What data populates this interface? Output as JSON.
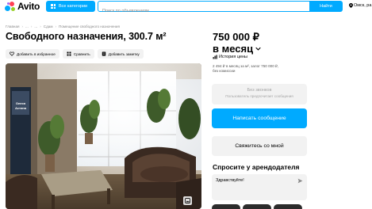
{
  "header": {
    "logo_text": "Avito",
    "categories_label": "Все категории",
    "search_placeholder": "Поиск по объявлениям",
    "search_button": "Найти",
    "location": "Омск, ра"
  },
  "breadcrumb": [
    "Главная",
    "...",
    "...",
    "Сдам",
    "Помещение свободного назначения"
  ],
  "title": "Свободного назначения, 300.7 м²",
  "actions": {
    "favorite": "Добавить в избранное",
    "compare": "Сравнить",
    "note": "Добавить заметку"
  },
  "photo": {
    "banner_line1": "Олеся",
    "banner_line2": "Астина"
  },
  "price": {
    "amount": "750 000 ₽",
    "period": "в месяц",
    "history_label": "История цены",
    "details_line1": "2 494 ₽ в месяц за м², залог 750 000 ₽,",
    "details_line2": "без комиссии"
  },
  "contact": {
    "no_calls_title": "Без звонков",
    "no_calls_subtitle": "Пользователь предпочитает сообщения",
    "message_button": "Написать сообщение",
    "contact_button": "Свяжитесь со мной"
  },
  "ask": {
    "title": "Спросите у арендодателя",
    "message_value": "Здравствуйте!"
  },
  "colors": {
    "accent": "#00aaff",
    "logo_blue": "#00aaff",
    "logo_red": "#ff4053",
    "logo_green": "#97cf26",
    "logo_purple": "#a169f7"
  }
}
